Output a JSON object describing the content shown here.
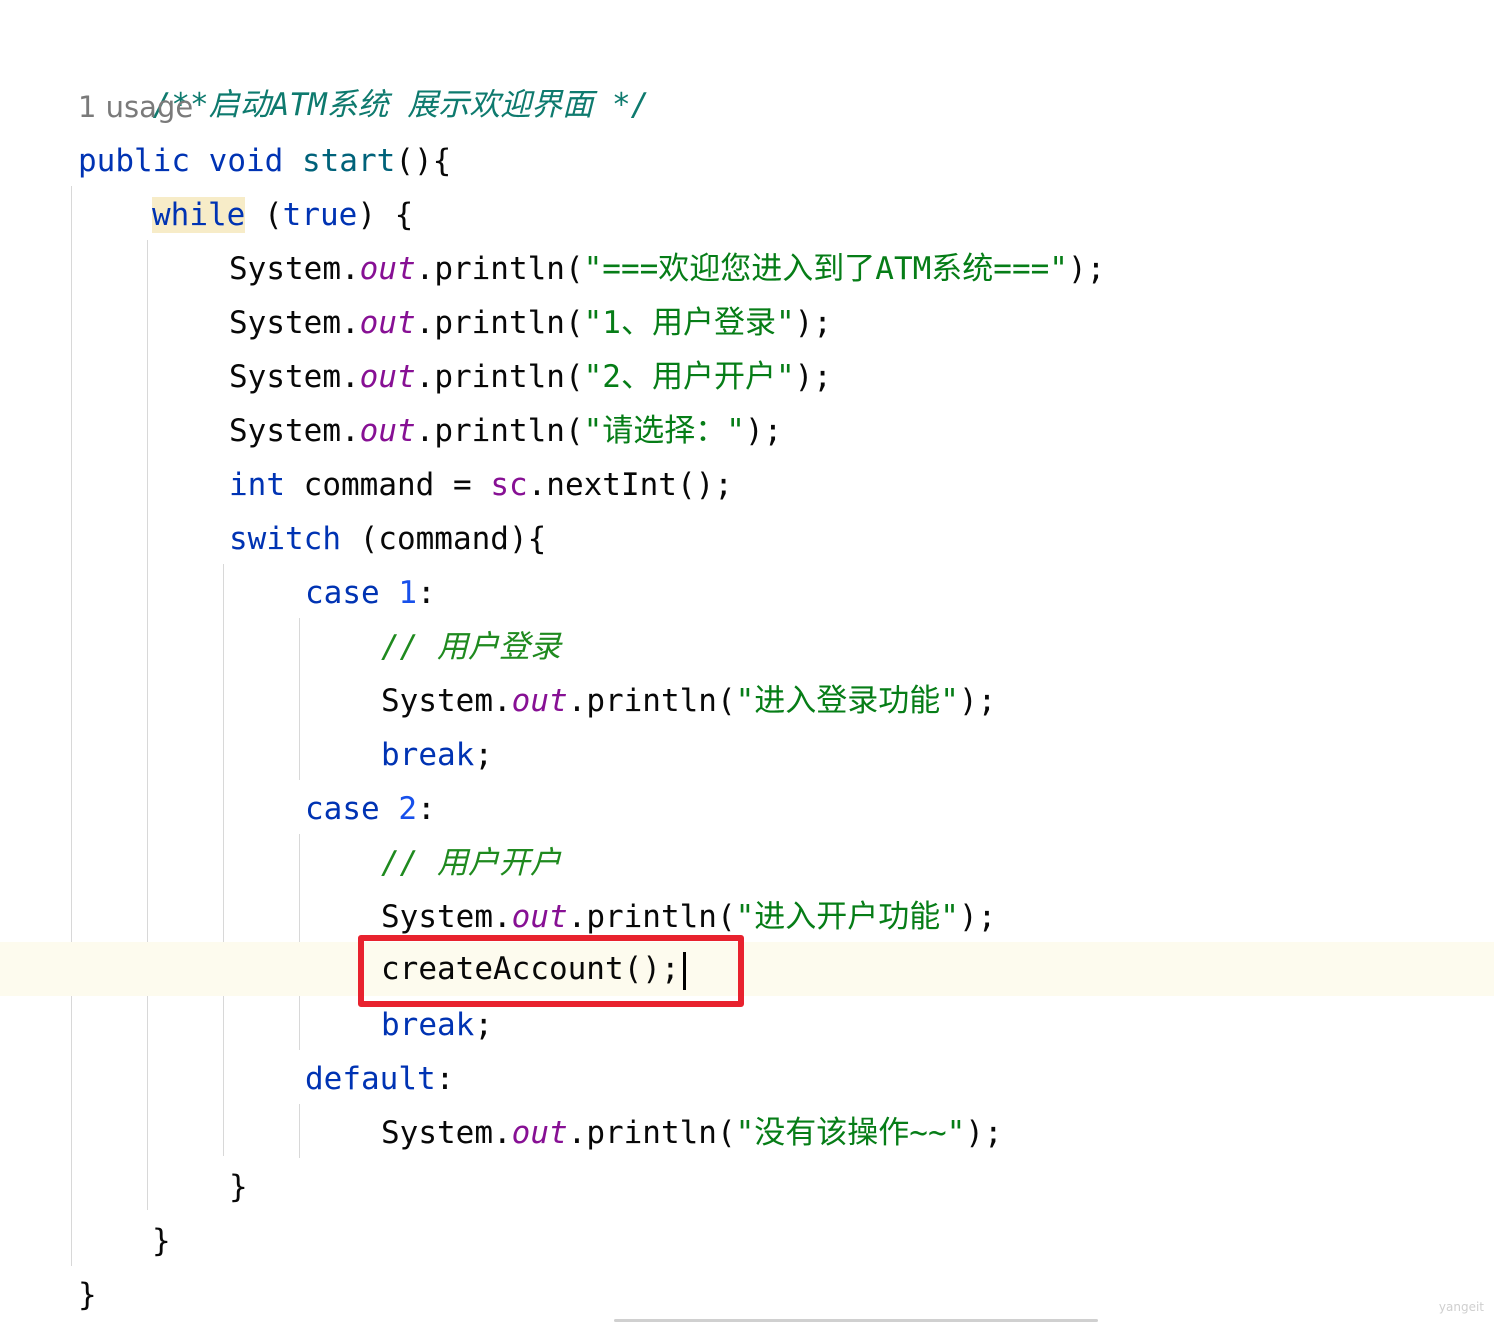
{
  "editor": {
    "doc_comment": "/**启动ATM系统 展示欢迎界面 */",
    "usage_hint": "1 usage",
    "lines": {
      "l01_kw1": "public",
      "l01_kw2": "void",
      "l01_fn": "start",
      "l01_rest": "(){",
      "l02_kw": "while",
      "l02_rest1": " (",
      "l02_kw2": "true",
      "l02_rest2": ") {",
      "sys": "System.",
      "out": "out",
      "println_open": ".println(",
      "close_stmt": ");",
      "s1": "\"===欢迎您进入到了ATM系统===\"",
      "s2": "\"1、用户登录\"",
      "s3": "\"2、用户开户\"",
      "s4": "\"请选择：\"",
      "int_kw": "int",
      "int_rest1": " command = ",
      "int_sc": "sc",
      "int_rest2": ".nextInt();",
      "switch_kw": "switch",
      "switch_rest": " (command){",
      "case_kw": "case",
      "case1_num": "1",
      "case2_num": "2",
      "colon": ":",
      "cmt_login": "// 用户登录",
      "s_login": "\"进入登录功能\"",
      "break_kw": "break",
      "semi": ";",
      "cmt_register": "// 用户开户",
      "s_register": "\"进入开户功能\"",
      "create_account": "createAccount();",
      "default_kw": "default",
      "s_default": "\"没有该操作~~\"",
      "brace_close": "}"
    }
  },
  "watermark": "yangeit",
  "colors": {
    "keyword": "#0033b3",
    "string": "#067d17",
    "field": "#871094",
    "number": "#1750eb",
    "comment": "#1f8a1f",
    "highlight_box": "#e8222e"
  }
}
